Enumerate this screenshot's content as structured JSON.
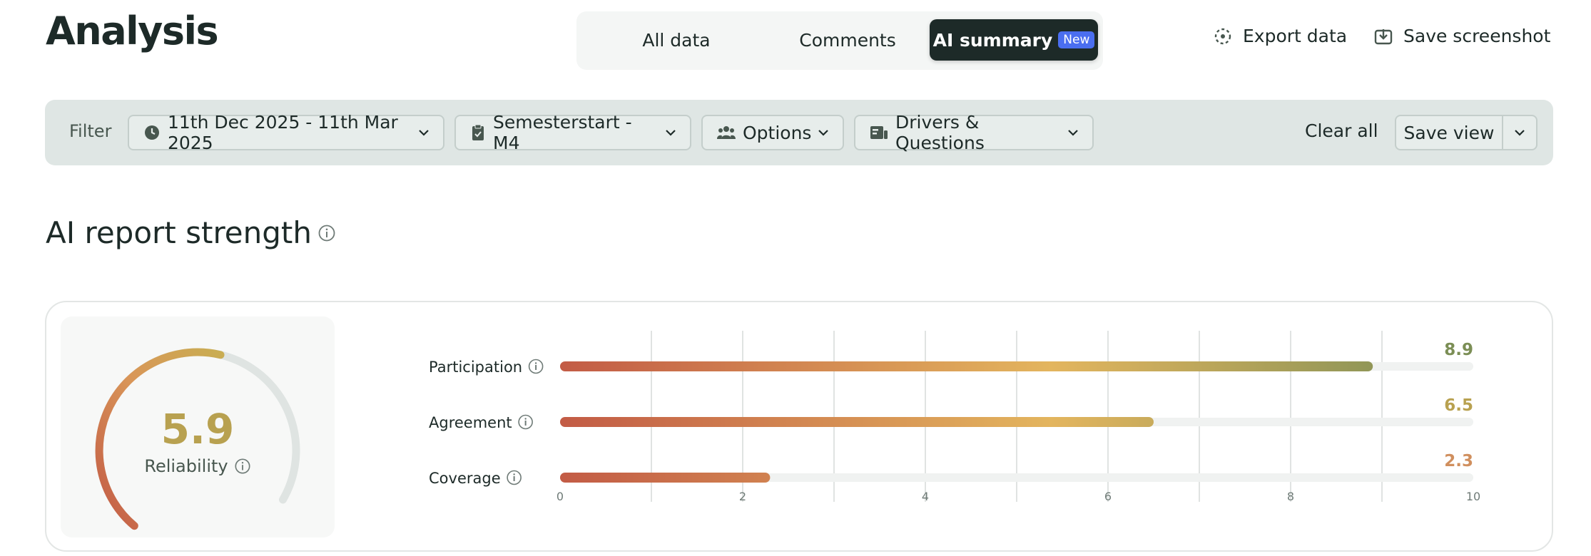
{
  "header": {
    "title": "Analysis",
    "tabs": [
      {
        "label": "All data"
      },
      {
        "label": "Comments"
      },
      {
        "label": "AI summary",
        "badge": "New",
        "active": true
      }
    ],
    "export_label": "Export data",
    "screenshot_label": "Save screenshot"
  },
  "filter": {
    "label": "Filter",
    "date_range": "11th Dec 2025 - 11th Mar 2025",
    "survey": "Semesterstart - M4",
    "options": "Options",
    "drivers": "Drivers & Questions",
    "clear_all": "Clear all",
    "save_view": "Save view"
  },
  "section": {
    "title": "AI report strength"
  },
  "reliability": {
    "value": "5.9",
    "score": 5.9,
    "max": 10,
    "label": "Reliability"
  },
  "colors": {
    "dark": "#1d2a28",
    "accent_badge": "#4a6ef0",
    "gradient_low": "#c25a45",
    "gradient_mid": "#e3b55e",
    "gradient_high": "#7b8e55",
    "track": "#f0f2f1"
  },
  "icons": {
    "export": "export-icon",
    "screenshot": "download-icon",
    "date": "clock-icon",
    "survey": "clipboard-check-icon",
    "options": "people-icon",
    "drivers": "id-card-icon",
    "info": "info-icon",
    "chevron": "chevron-down-icon"
  },
  "chart_data": {
    "type": "bar",
    "orientation": "horizontal",
    "categories": [
      "Participation",
      "Agreement",
      "Coverage"
    ],
    "values": [
      8.9,
      6.5,
      2.3
    ],
    "value_labels": [
      "8.9",
      "6.5",
      "2.3"
    ],
    "xlim": [
      0,
      10
    ],
    "xticks": [
      0,
      2,
      4,
      6,
      8,
      10
    ],
    "grid": true,
    "value_colors": [
      "#7b8e55",
      "#b8a150",
      "#d08f5e"
    ]
  }
}
